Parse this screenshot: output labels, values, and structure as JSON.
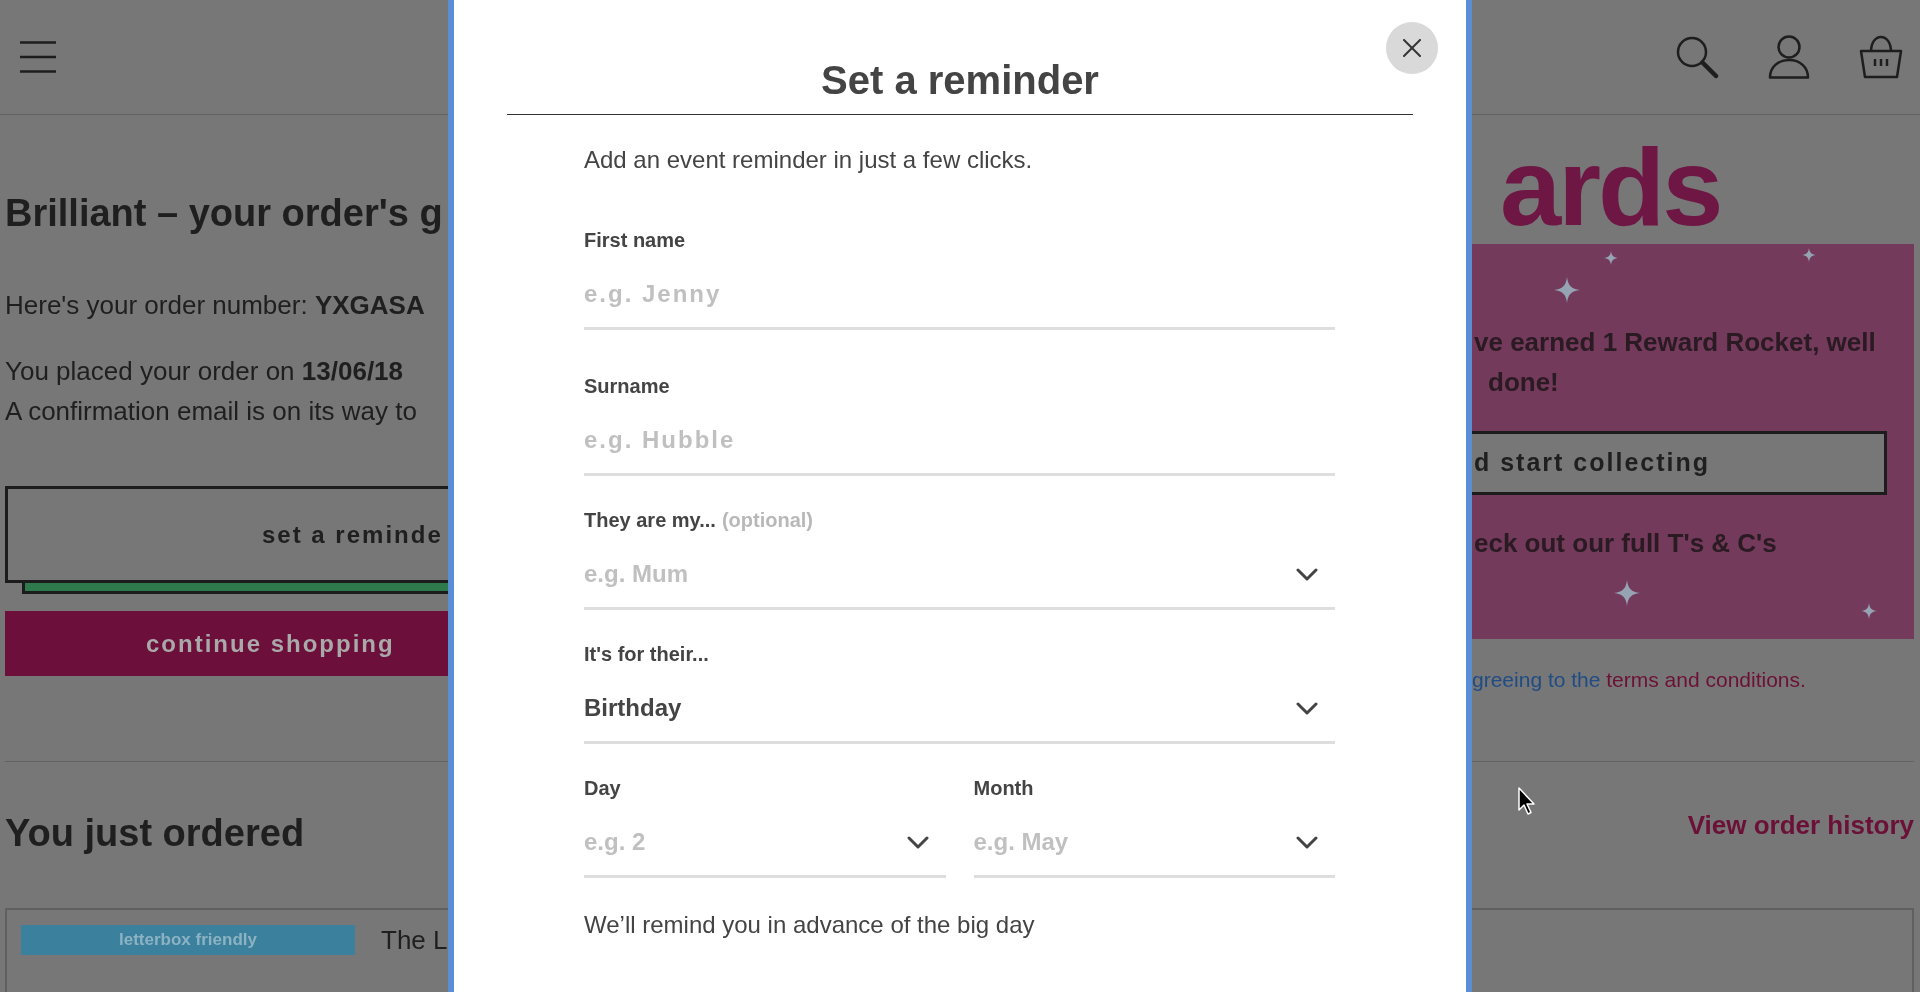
{
  "page": {
    "heading": "Brilliant – your order's g",
    "order_number": "Here's your order number: **YXGASA**",
    "order_date": "You placed your order on **13/06/18**",
    "email_note": "A confirmation email is on its way to",
    "reminder_button": "set a reminde",
    "continue_button": "continue shopping",
    "ordered_heading": "You just ordered",
    "ordered_item": {
      "tag": "letterbox friendly",
      "title": "The L"
    },
    "order_history_link": "View order history"
  },
  "rewards": {
    "title": "ards",
    "message_lines": [
      "ve earned 1 Reward Rocket, well",
      "done!"
    ],
    "collect_button": "d start collecting",
    "terms_note": "eck out our full T's & C's",
    "agreement": {
      "text": "greeing to the",
      "link": "terms and conditions."
    }
  },
  "modal": {
    "title": "Set a reminder",
    "intro": "Add an event reminder in just a few clicks.",
    "fields": [
      {
        "kind": "text",
        "label": "First name",
        "placeholder": "e.g. Jenny"
      },
      {
        "kind": "text",
        "label": "Surname",
        "placeholder": "e.g. Hubble"
      },
      {
        "kind": "select",
        "label": "They are my...",
        "hint": "(optional)",
        "placeholder": "e.g. Mum"
      },
      {
        "kind": "select",
        "label": "It's for their...",
        "value": "Birthday"
      }
    ],
    "date_fields": [
      {
        "kind": "select",
        "label": "Day",
        "placeholder": "e.g. 2"
      },
      {
        "kind": "select",
        "label": "Month",
        "placeholder": "e.g. May"
      }
    ],
    "note": "We’ll remind you in advance of the big day"
  }
}
